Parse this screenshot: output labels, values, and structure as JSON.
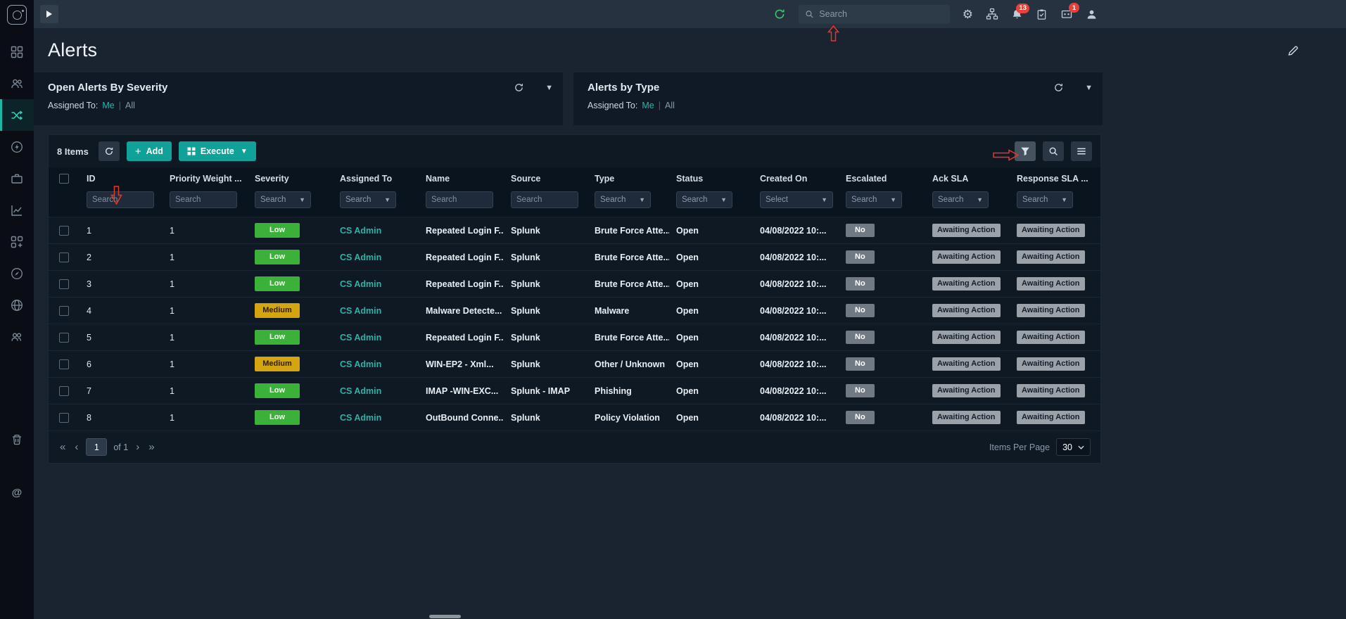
{
  "topbar": {
    "search_placeholder": "Search",
    "notifications_badge": "13",
    "product_badge": "1"
  },
  "page": {
    "title": "Alerts"
  },
  "sidebar": {
    "items": [
      "dashboard",
      "users",
      "alerts",
      "automation",
      "cases",
      "reports",
      "apps",
      "threat-intel",
      "web",
      "teams",
      "trash",
      "mentions"
    ],
    "active_item": "alerts"
  },
  "panels": {
    "left": {
      "title": "Open Alerts By Severity",
      "assigned_label": "Assigned To:",
      "me": "Me",
      "divider": "|",
      "all": "All"
    },
    "right": {
      "title": "Alerts by Type",
      "assigned_label": "Assigned To:",
      "me": "Me",
      "divider": "|",
      "all": "All"
    }
  },
  "toolbar": {
    "items_count": "8 Items",
    "add_label": "Add",
    "execute_label": "Execute"
  },
  "table": {
    "columns": [
      {
        "key": "id",
        "label": "ID",
        "filter": "Search",
        "filter_kind": "input"
      },
      {
        "key": "priority_weight",
        "label": "Priority Weight ...",
        "filter": "Search",
        "filter_kind": "input"
      },
      {
        "key": "severity",
        "label": "Severity",
        "filter": "Search",
        "filter_kind": "select"
      },
      {
        "key": "assigned_to",
        "label": "Assigned To",
        "filter": "Search",
        "filter_kind": "select"
      },
      {
        "key": "name",
        "label": "Name",
        "filter": "Search",
        "filter_kind": "input"
      },
      {
        "key": "source",
        "label": "Source",
        "filter": "Search",
        "filter_kind": "input"
      },
      {
        "key": "type",
        "label": "Type",
        "filter": "Search",
        "filter_kind": "select"
      },
      {
        "key": "status",
        "label": "Status",
        "filter": "Search",
        "filter_kind": "select"
      },
      {
        "key": "created_on",
        "label": "Created On",
        "filter": "Select",
        "filter_kind": "select-wide"
      },
      {
        "key": "escalated",
        "label": "Escalated",
        "filter": "Search",
        "filter_kind": "select"
      },
      {
        "key": "ack_sla",
        "label": "Ack SLA",
        "filter": "Search",
        "filter_kind": "select"
      },
      {
        "key": "response_sla",
        "label": "Response SLA ...",
        "filter": "Search",
        "filter_kind": "select"
      }
    ],
    "rows": [
      {
        "id": "1",
        "priority_weight": "1",
        "severity": "Low",
        "assigned_to": "CS Admin",
        "name": "Repeated Login F...",
        "source": "Splunk",
        "type": "Brute Force Atte...",
        "status": "Open",
        "created_on": "04/08/2022 10:...",
        "escalated": "No",
        "ack_sla": "Awaiting Action",
        "response_sla": "Awaiting Action"
      },
      {
        "id": "2",
        "priority_weight": "1",
        "severity": "Low",
        "assigned_to": "CS Admin",
        "name": "Repeated Login F...",
        "source": "Splunk",
        "type": "Brute Force Atte...",
        "status": "Open",
        "created_on": "04/08/2022 10:...",
        "escalated": "No",
        "ack_sla": "Awaiting Action",
        "response_sla": "Awaiting Action"
      },
      {
        "id": "3",
        "priority_weight": "1",
        "severity": "Low",
        "assigned_to": "CS Admin",
        "name": "Repeated Login F...",
        "source": "Splunk",
        "type": "Brute Force Atte...",
        "status": "Open",
        "created_on": "04/08/2022 10:...",
        "escalated": "No",
        "ack_sla": "Awaiting Action",
        "response_sla": "Awaiting Action"
      },
      {
        "id": "4",
        "priority_weight": "1",
        "severity": "Medium",
        "assigned_to": "CS Admin",
        "name": "Malware Detecte...",
        "source": "Splunk",
        "type": "Malware",
        "status": "Open",
        "created_on": "04/08/2022 10:...",
        "escalated": "No",
        "ack_sla": "Awaiting Action",
        "response_sla": "Awaiting Action"
      },
      {
        "id": "5",
        "priority_weight": "1",
        "severity": "Low",
        "assigned_to": "CS Admin",
        "name": "Repeated Login F...",
        "source": "Splunk",
        "type": "Brute Force Atte...",
        "status": "Open",
        "created_on": "04/08/2022 10:...",
        "escalated": "No",
        "ack_sla": "Awaiting Action",
        "response_sla": "Awaiting Action"
      },
      {
        "id": "6",
        "priority_weight": "1",
        "severity": "Medium",
        "assigned_to": "CS Admin",
        "name": "WIN-EP2 - Xml...",
        "source": "Splunk",
        "type": "Other / Unknown",
        "status": "Open",
        "created_on": "04/08/2022 10:...",
        "escalated": "No",
        "ack_sla": "Awaiting Action",
        "response_sla": "Awaiting Action"
      },
      {
        "id": "7",
        "priority_weight": "1",
        "severity": "Low",
        "assigned_to": "CS Admin",
        "name": "IMAP -WIN-EXC...",
        "source": "Splunk - IMAP",
        "type": "Phishing",
        "status": "Open",
        "created_on": "04/08/2022 10:...",
        "escalated": "No",
        "ack_sla": "Awaiting Action",
        "response_sla": "Awaiting Action"
      },
      {
        "id": "8",
        "priority_weight": "1",
        "severity": "Low",
        "assigned_to": "CS Admin",
        "name": "OutBound Conne...",
        "source": "Splunk",
        "type": "Policy Violation",
        "status": "Open",
        "created_on": "04/08/2022 10:...",
        "escalated": "No",
        "ack_sla": "Awaiting Action",
        "response_sla": "Awaiting Action"
      }
    ]
  },
  "pagination": {
    "page": "1",
    "of_label": "of 1",
    "first": "«",
    "prev": "‹",
    "next": "›",
    "last": "»",
    "items_per_page_label": "Items Per Page",
    "items_per_page": "30"
  },
  "colors": {
    "accent_teal": "#14b8a6",
    "severity_low": "#3cb13a",
    "severity_medium": "#d5a411",
    "badge_gray": "#717a84",
    "badge_sla": "#9aa1a9",
    "annotation_red": "#e8352b"
  },
  "annotations": {
    "arrows": [
      "up-at-global-search",
      "down-at-id-filter",
      "right-at-filter-button"
    ]
  }
}
